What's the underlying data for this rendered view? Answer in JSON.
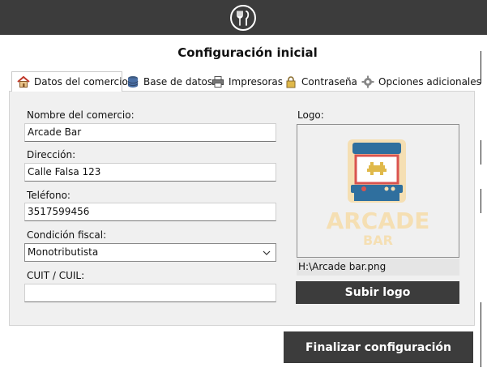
{
  "header": {
    "logo_icon": "fork-knife-icon"
  },
  "title": "Configuración inicial",
  "tabs": [
    {
      "label": "Datos del comercio",
      "icon": "house-icon",
      "active": true
    },
    {
      "label": "Base de datos",
      "icon": "database-icon",
      "active": false
    },
    {
      "label": "Impresoras",
      "icon": "printer-icon",
      "active": false
    },
    {
      "label": "Contraseña",
      "icon": "lock-icon",
      "active": false
    },
    {
      "label": "Opciones adicionales",
      "icon": "gear-icon",
      "active": false
    }
  ],
  "form": {
    "nombre_label": "Nombre del comercio:",
    "nombre_value": "Arcade Bar",
    "direccion_label": "Dirección:",
    "direccion_value": "Calle Falsa 123",
    "telefono_label": "Teléfono:",
    "telefono_value": "3517599456",
    "condicion_label": "Condición fiscal:",
    "condicion_value": "Monotributista",
    "cuit_label": "CUIT / CUIL:",
    "cuit_value": ""
  },
  "logo": {
    "label": "Logo:",
    "image_text_main": "ARCADE",
    "image_text_sub": "BAR",
    "path": "H:\\Arcade bar.png",
    "upload_label": "Subir logo"
  },
  "finish_label": "Finalizar configuración",
  "colors": {
    "dark": "#3c3c3c",
    "panel": "#f0f0f0",
    "arcade_blue": "#2f6f9e",
    "arcade_red": "#d9534f",
    "arcade_cream": "#f5dfb3"
  }
}
